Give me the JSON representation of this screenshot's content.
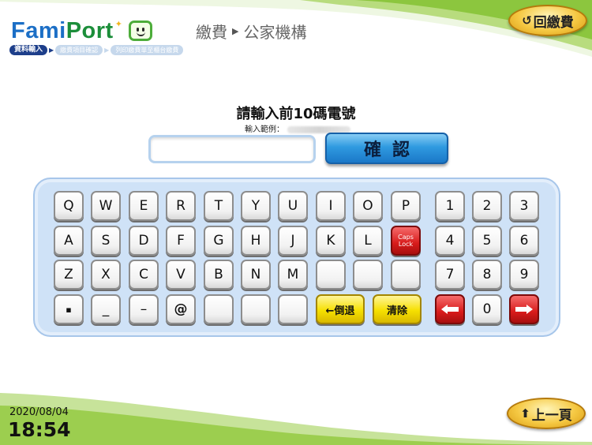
{
  "header": {
    "logo_prefix": "Fami",
    "logo_suffix": "Port",
    "path_service": "繳費",
    "path_category": "公家機構",
    "back_to_payment": "回繳費"
  },
  "breadcrumb": {
    "steps": [
      "資料輸入",
      "繳費項目確認",
      "列印繳費單至櫃台繳費"
    ],
    "active_index": 0
  },
  "prompt": {
    "title": "請輸入前10碼電號",
    "example_label": "輸入範例：",
    "input_value": "",
    "confirm_label": "確認"
  },
  "keyboard": {
    "row1": [
      "Q",
      "W",
      "E",
      "R",
      "T",
      "Y",
      "U",
      "I",
      "O",
      "P"
    ],
    "row2": [
      "A",
      "S",
      "D",
      "F",
      "G",
      "H",
      "J",
      "K",
      "L"
    ],
    "caps_line1": "Caps",
    "caps_line2": "Lock",
    "row3": [
      "Z",
      "X",
      "C",
      "V",
      "B",
      "N",
      "M",
      "",
      "",
      ""
    ],
    "row4": [
      "▪",
      "_",
      "–",
      "@",
      "",
      "",
      ""
    ],
    "backspace_label": "←倒退",
    "clear_label": "清除",
    "numpad": [
      "1",
      "2",
      "3",
      "4",
      "5",
      "6",
      "7",
      "8",
      "9",
      "0"
    ],
    "colors": {
      "panel": "#cfe2f7",
      "yellow_key": "#f6e000",
      "red_key": "#d81b1b"
    }
  },
  "footer": {
    "date": "2020/08/04",
    "time": "18:54",
    "prev_page": "上一頁"
  }
}
